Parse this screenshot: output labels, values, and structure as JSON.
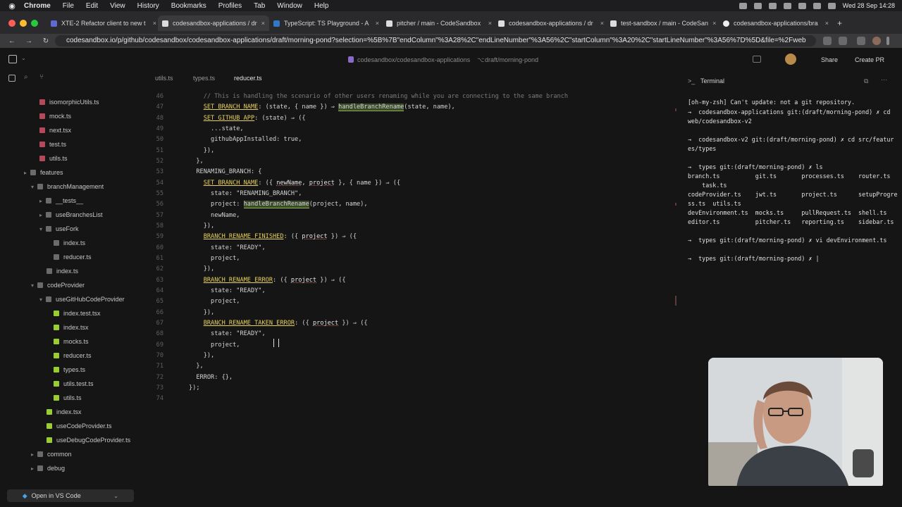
{
  "menubar": {
    "app": "Chrome",
    "items": [
      "File",
      "Edit",
      "View",
      "History",
      "Bookmarks",
      "Profiles",
      "Tab",
      "Window",
      "Help"
    ],
    "clock": "Wed 28 Sep  14:28"
  },
  "browser": {
    "tabs": [
      {
        "label": "XTE-2 Refactor client to new t"
      },
      {
        "label": "codesandbox-applications / dr"
      },
      {
        "label": "TypeScript: TS Playground - A"
      },
      {
        "label": "pitcher / main - CodeSandbox"
      },
      {
        "label": "codesandbox-applications / dr"
      },
      {
        "label": "test-sandbox / main - CodeSan"
      },
      {
        "label": "codesandbox-applications/bra"
      }
    ],
    "url": "codesandbox.io/p/github/codesandbox/codesandbox-applications/draft/morning-pond?selection=%5B%7B\"endColumn\"%3A28%2C\"endLineNumber\"%3A56%2C\"startColumn\"%3A20%2C\"startLineNumber\"%3A56%7D%5D&file=%2Fweb"
  },
  "appbar": {
    "repo": "codesandbox/codesandbox-applications",
    "branch": "draft/morning-pond",
    "share": "Share",
    "create_pr": "Create PR"
  },
  "editor": {
    "tabs": [
      "utils.ts",
      "types.ts",
      "reducer.ts"
    ],
    "active_tab": "reducer.ts"
  },
  "sidebar": {
    "items": [
      {
        "label": "isomorphicUtils.ts"
      },
      {
        "label": "mock.ts"
      },
      {
        "label": "next.tsx"
      },
      {
        "label": "test.ts"
      },
      {
        "label": "utils.ts"
      },
      {
        "label": "features"
      },
      {
        "label": "branchManagement"
      },
      {
        "label": "__tests__"
      },
      {
        "label": "useBranchesList"
      },
      {
        "label": "useFork"
      },
      {
        "label": "index.ts"
      },
      {
        "label": "reducer.ts"
      },
      {
        "label": "index.ts"
      },
      {
        "label": "codeProvider"
      },
      {
        "label": "useGitHubCodeProvider"
      },
      {
        "label": "index.test.tsx"
      },
      {
        "label": "index.tsx"
      },
      {
        "label": "mocks.ts"
      },
      {
        "label": "reducer.ts"
      },
      {
        "label": "types.ts"
      },
      {
        "label": "utils.test.ts"
      },
      {
        "label": "utils.ts"
      },
      {
        "label": "index.tsx"
      },
      {
        "label": "useCodeProvider.ts"
      },
      {
        "label": "useDebugCodeProvider.ts"
      },
      {
        "label": "common"
      },
      {
        "label": "debug"
      }
    ],
    "open_vscode": "Open in VS Code"
  },
  "terminal": {
    "title": "Terminal",
    "lines": [
      "[oh-my-zsh] Can't update: not a git repository.",
      "→  codesandbox-applications git:(draft/morning-pond) ✗ cd",
      "web/codesandbox-v2",
      "→  codesandbox-v2 git:(draft/morning-pond) ✗ cd src/featur",
      "es/types",
      "→  types git:(draft/morning-pond) ✗ ls",
      "branch.ts          git.ts       processes.ts    router.ts",
      "    task.ts",
      "codeProvider.ts    jwt.ts       project.ts      setupProgre",
      "ss.ts  utils.ts",
      "devEnvironment.ts  mocks.ts     pullRequest.ts  shell.ts",
      "editor.ts          pitcher.ts   reporting.ts    sidebar.ts",
      "→  types git:(draft/morning-pond) ✗ vi devEnvironment.ts",
      "→  types git:(draft/morning-pond) ✗ |"
    ]
  },
  "code": {
    "lines": [
      {
        "n": "46",
        "t": "    // This is handling the scenario of other users renaming while you are connecting to the same branch"
      },
      {
        "n": "47",
        "t": "    SET_BRANCH_NAME: (state, { name }) ⇒ handleBranchRename(state, name),"
      },
      {
        "n": "48",
        "t": "    SET_GITHUB_APP: (state) ⇒ ({"
      },
      {
        "n": "49",
        "t": "      ...state,"
      },
      {
        "n": "50",
        "t": "      githubAppInstalled: true,"
      },
      {
        "n": "51",
        "t": "    }),"
      },
      {
        "n": "52",
        "t": "  },"
      },
      {
        "n": "53",
        "t": "  RENAMING_BRANCH: {"
      },
      {
        "n": "54",
        "t": "    SET_BRANCH_NAME: ({ newName, project }, { name }) ⇒ ({"
      },
      {
        "n": "55",
        "t": "      state: \"RENAMING_BRANCH\","
      },
      {
        "n": "56",
        "t": "      project: handleBranchRename(project, name),"
      },
      {
        "n": "57",
        "t": "      newName,"
      },
      {
        "n": "58",
        "t": "    }),"
      },
      {
        "n": "59",
        "t": "    BRANCH_RENAME_FINISHED: ({ project }) ⇒ ({"
      },
      {
        "n": "60",
        "t": "      state: \"READY\","
      },
      {
        "n": "61",
        "t": "      project,"
      },
      {
        "n": "62",
        "t": "    }),"
      },
      {
        "n": "63",
        "t": "    BRANCH_RENAME_ERROR: ({ project }) ⇒ ({"
      },
      {
        "n": "64",
        "t": "      state: \"READY\","
      },
      {
        "n": "65",
        "t": "      project,"
      },
      {
        "n": "66",
        "t": "    }),"
      },
      {
        "n": "67",
        "t": "    BRANCH_RENAME_TAKEN_ERROR: ({ project }) ⇒ ({"
      },
      {
        "n": "68",
        "t": "      state: \"READY\","
      },
      {
        "n": "69",
        "t": "      project,"
      },
      {
        "n": "70",
        "t": "    }),"
      },
      {
        "n": "71",
        "t": "  },"
      },
      {
        "n": "72",
        "t": "  ERROR: {},"
      },
      {
        "n": "73",
        "t": "});"
      },
      {
        "n": "74",
        "t": ""
      }
    ]
  }
}
